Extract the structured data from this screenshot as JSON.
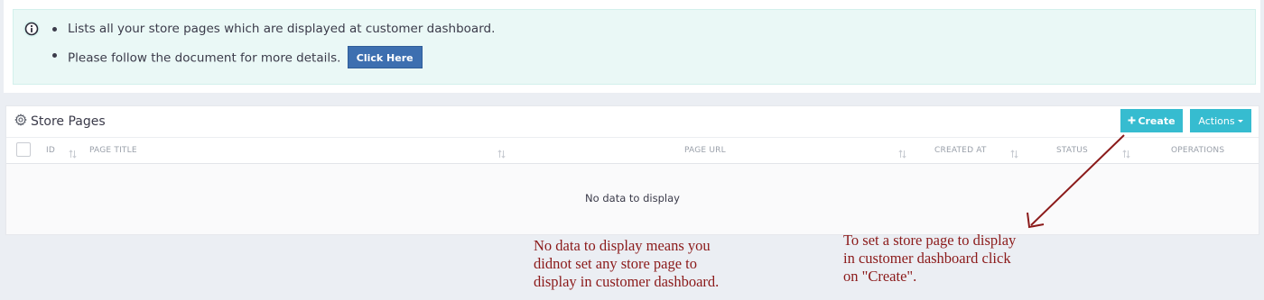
{
  "info": {
    "icon": "info-icon",
    "line1": "Lists all your store pages which are displayed at customer dashboard.",
    "line2": "Please follow the document for more details.",
    "button_label": "Click Here"
  },
  "panel": {
    "title_icon": "gear-icon",
    "title": "Store Pages",
    "create_label": "Create",
    "actions_label": "Actions",
    "columns": {
      "id": "ID",
      "page_title": "PAGE TITLE",
      "page_url": "PAGE URL",
      "created_at": "CREATED AT",
      "status": "STATUS",
      "operations": "OPERATIONS"
    },
    "empty_text": "No data to display"
  },
  "annotations": {
    "left_note": "No data to display means you\ndidnot set any store page to\ndisplay in customer dashboard.",
    "right_note": "To set a store page to display\nin customer dashboard click\non \"Create\".",
    "color": "#8b1a1a"
  }
}
